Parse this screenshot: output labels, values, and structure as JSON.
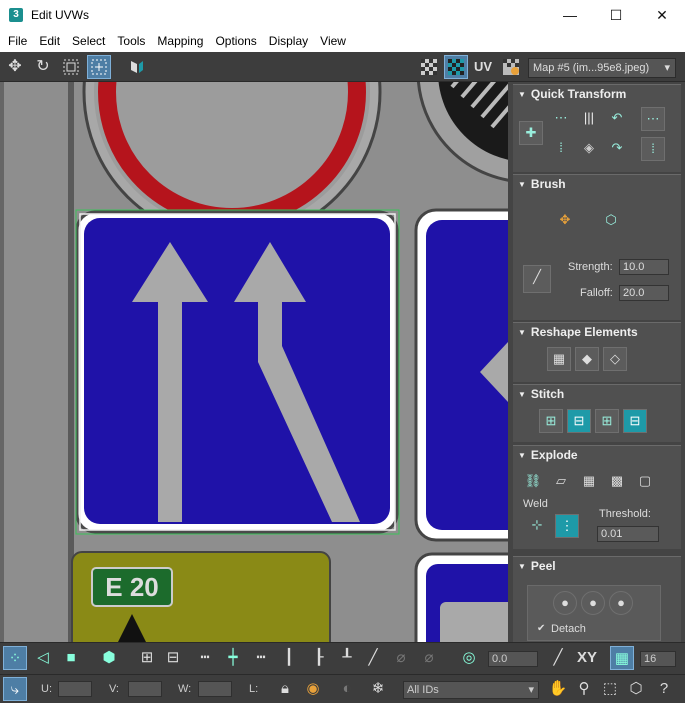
{
  "window": {
    "title": "Edit UVWs",
    "app_icon": "3",
    "minimize": "—",
    "maximize": "☐",
    "close": "✕"
  },
  "menu": [
    "File",
    "Edit",
    "Select",
    "Tools",
    "Mapping",
    "Options",
    "Display",
    "View"
  ],
  "toolbar": {
    "uv_label": "UV",
    "map_dropdown": "Map #5 (im...95e8.jpeg)",
    "map_dropdown_arrow": "▾"
  },
  "viewport": {
    "sign_label": "E 20"
  },
  "panel": {
    "quick_transform": "Quick Transform",
    "brush": "Brush",
    "strength_label": "Strength:",
    "strength_value": "10.0",
    "falloff_label": "Falloff:",
    "falloff_value": "20.0",
    "reshape": "Reshape Elements",
    "stitch": "Stitch",
    "explode": "Explode",
    "weld_label": "Weld",
    "threshold_label": "Threshold:",
    "threshold_value": "0.01",
    "peel": "Peel",
    "detach_label": "Detach",
    "detach_checked": "✔"
  },
  "bottom": {
    "rotate_value": "0.0",
    "xy_label": "XY",
    "grid_value": "16",
    "u_label": "U:",
    "v_label": "V:",
    "w_label": "W:",
    "l_label": "L:",
    "ids_select": "All IDs"
  },
  "colors": {
    "accent": "#1e9aa8",
    "sign_blue": "#1f12a8",
    "sign_red": "#b5141c",
    "sign_yellow": "#8a8a16",
    "sign_green": "#1c6b2c"
  }
}
